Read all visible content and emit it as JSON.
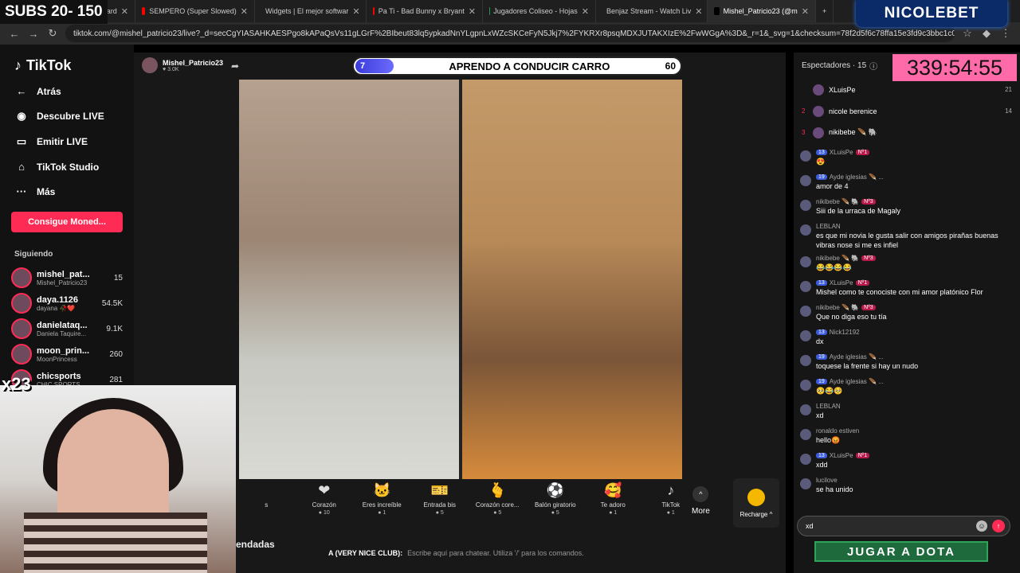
{
  "overlay": {
    "subs": "SUBS 20- 150",
    "brand": "NICOLEBET",
    "timer": "339:54:55",
    "x23": "x23",
    "jugar": "JUGAR A DOTA",
    "ended": "endadas"
  },
  "browser": {
    "tabs": [
      {
        "label": "board",
        "color": "#4a4a4a"
      },
      {
        "label": "SEMPERO (Super Slowed)",
        "color": "#ff0000"
      },
      {
        "label": "Widgets | El mejor softwar",
        "color": "#ffffff"
      },
      {
        "label": "Pa Ti - Bad Bunny x Bryant",
        "color": "#ff0000"
      },
      {
        "label": "Jugadores Coliseo - Hojas",
        "color": "#0f9d58"
      },
      {
        "label": "Benjaz Stream - Watch Liv",
        "color": "#53fc18"
      },
      {
        "label": "Mishel_Patricio23 (@m",
        "color": "#000000"
      }
    ],
    "url": "tiktok.com/@mishel_patricio23/live?_d=secCgYIASAHKAESPgo8kAPaQsVs11gLGrF%2BIbeut83lq5ypkadNnYLgpnLxWZcSKCeFyN5Jkj7%2FYKRXr8psqMDXJUTAKXIzE%2FwWGgA%3D&_r=1&_svg=1&checksum=78f2d5f6c78ffa15e3fd9c3bbc1c0..."
  },
  "sidebar": {
    "logo": "TikTok",
    "items": [
      {
        "label": "Atrás",
        "icon": "←"
      },
      {
        "label": "Descubre LIVE",
        "icon": "◉"
      },
      {
        "label": "Emitir LIVE",
        "icon": "▭"
      },
      {
        "label": "TikTok Studio",
        "icon": "⌂"
      },
      {
        "label": "Más",
        "icon": "···"
      }
    ],
    "coins_button": "Consigue Moned...",
    "following_title": "Siguiendo",
    "following": [
      {
        "name": "mishel_pat...",
        "sub": "Mishel_Patricio23",
        "count": "15"
      },
      {
        "name": "daya.1126",
        "sub": "dayana 🥀❤️",
        "count": "54.5K"
      },
      {
        "name": "danielataq...",
        "sub": "Daniela Taquire...",
        "count": "9.1K"
      },
      {
        "name": "moon_prin...",
        "sub": "MoonPrincess",
        "count": "260"
      },
      {
        "name": "chicsports",
        "sub": "CHIC SPORTS",
        "count": "281"
      }
    ]
  },
  "live": {
    "host_name": "Mishel_Patricio23",
    "host_likes": "♥ 3.0K",
    "battle": {
      "left": "7",
      "title": "APRENDO A CONDUCIR CARRO",
      "right": "60"
    },
    "gifts": [
      {
        "name": "s",
        "icon": "",
        "price": ""
      },
      {
        "name": "Corazón",
        "icon": "❤",
        "price": "● 10"
      },
      {
        "name": "Eres increíble",
        "icon": "🐱",
        "price": "● 1"
      },
      {
        "name": "Entrada bis",
        "icon": "🎫",
        "price": "● 5"
      },
      {
        "name": "Corazón core...",
        "icon": "🫰",
        "price": "● 5"
      },
      {
        "name": "Balón giratorio",
        "icon": "⚽",
        "price": "● 5"
      },
      {
        "name": "Te adoro",
        "icon": "🥰",
        "price": "● 1"
      },
      {
        "name": "TikTok",
        "icon": "♪",
        "price": "● 1"
      }
    ],
    "more": "More",
    "recharge": "Recharge ^"
  },
  "chat": {
    "viewers_label": "Espectadores · 15",
    "top_viewers": [
      {
        "rank": "",
        "name": "XLuisPe",
        "score": "21"
      },
      {
        "rank": "2",
        "name": "nicole berenice",
        "score": "14"
      },
      {
        "rank": "3",
        "name": "nikibebe 🪶 🐘",
        "score": ""
      }
    ],
    "messages": [
      {
        "user": "XLuisPe",
        "lvl": "13",
        "rank": "Nº1",
        "text": "😍"
      },
      {
        "user": "Ayde iglesias 🪶 ...",
        "lvl": "19",
        "rank": "",
        "text": "amor de 4"
      },
      {
        "user": "nikibebe 🪶 🐘",
        "lvl": "",
        "rank": "Nº3",
        "text": "Siii de la urraca de Magaly"
      },
      {
        "user": "LEBLAN",
        "lvl": "",
        "rank": "",
        "text": "es que mi novia le gusta salir con amigos pirañas buenas vibras nose si me es infiel"
      },
      {
        "user": "nikibebe 🪶 🐘",
        "lvl": "",
        "rank": "Nº3",
        "text": "😂😂😂😂"
      },
      {
        "user": "XLuisPe",
        "lvl": "13",
        "rank": "Nº1",
        "text": "Mishel como te conociste con mi amor platónico Flor"
      },
      {
        "user": "nikibebe 🪶 🐘",
        "lvl": "",
        "rank": "Nº3",
        "text": "Que no diga eso tu tía"
      },
      {
        "user": "Nick12192",
        "lvl": "13",
        "rank": "",
        "text": "dx"
      },
      {
        "user": "Ayde iglesias 🪶 ...",
        "lvl": "19",
        "rank": "",
        "text": "toquese la frente si hay un nudo"
      },
      {
        "user": "Ayde iglesias 🪶 ...",
        "lvl": "19",
        "rank": "",
        "text": "🥺😂🥺"
      },
      {
        "user": "LEBLAN",
        "lvl": "",
        "rank": "",
        "text": "xd"
      },
      {
        "user": "ronaldo estiven",
        "lvl": "",
        "rank": "",
        "text": "hello😡"
      },
      {
        "user": "XLuisPe",
        "lvl": "13",
        "rank": "Nº1",
        "text": "xdd"
      },
      {
        "user": "lucilove",
        "lvl": "",
        "rank": "",
        "text": "se ha unido"
      }
    ],
    "input_value": "xd"
  },
  "stream_chat": {
    "channel": "A (VERY NICE CLUB):",
    "hint": "Escribe aquí para chatear. Utiliza '/' para los comandos."
  }
}
